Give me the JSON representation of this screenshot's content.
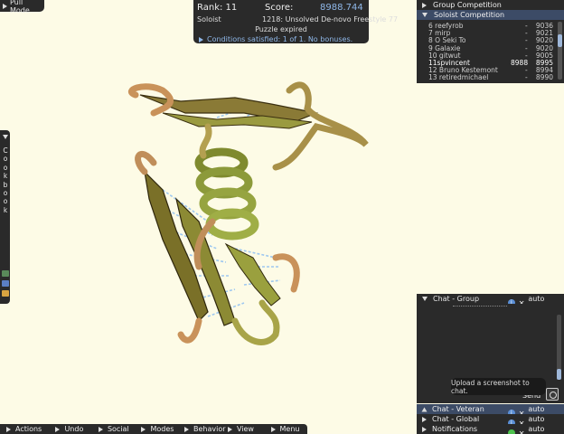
{
  "pull_mode": {
    "label": "Pull Mode"
  },
  "score_panel": {
    "rank_label": "Rank: 11",
    "score_label": "Score:",
    "score_value": "8988.744",
    "mode": "Soloist",
    "puzzle_title": "1218: Unsolved De-novo Freestyle 77",
    "status": "Puzzle expired",
    "conditions": "Conditions satisfied: 1 of 1. No bonuses."
  },
  "competition": {
    "group_label": "Group Competition",
    "soloist_label": "Soloist Competition",
    "rows": [
      {
        "name": "6 reefyrob",
        "own": "",
        "dash": "-",
        "score": "9036"
      },
      {
        "name": "7 mirp",
        "own": "",
        "dash": "-",
        "score": "9021"
      },
      {
        "name": "8 O Seki To",
        "own": "",
        "dash": "-",
        "score": "9020"
      },
      {
        "name": "9 Galaxie",
        "own": "",
        "dash": "-",
        "score": "9020"
      },
      {
        "name": "10 gitwut",
        "own": "",
        "dash": "-",
        "score": "9005"
      },
      {
        "name": "11spvincent",
        "own": "8988",
        "dash": "",
        "score": "8995"
      },
      {
        "name": "12 Bruno Kestemont",
        "own": "",
        "dash": "-",
        "score": "8994"
      },
      {
        "name": "13 retiredmichael",
        "own": "",
        "dash": "-",
        "score": "8990"
      }
    ]
  },
  "cookbook": {
    "label": "Cookbook"
  },
  "chat": {
    "group_label": "Chat - Group",
    "veteran_label": "Chat - Veteran",
    "global_label": "Chat - Global",
    "notifications_label": "Notifications",
    "auto_show": "auto show",
    "send_label": "Send",
    "tooltip": "Upload a screenshot to chat."
  },
  "bottom_menu": [
    {
      "label": "Actions"
    },
    {
      "label": "Undo"
    },
    {
      "label": "Social"
    },
    {
      "label": "Modes"
    },
    {
      "label": "Behavior"
    },
    {
      "label": "View"
    },
    {
      "label": "Menu"
    }
  ],
  "colors": {
    "background": "#fdfbe6",
    "panel": "#2a2a2a",
    "highlight": "#3c4b66",
    "accent_blue": "#8fb7e8",
    "protein_helix": "#8c9a3a",
    "protein_loop": "#c9925a",
    "hbond": "#9ec8f0"
  }
}
